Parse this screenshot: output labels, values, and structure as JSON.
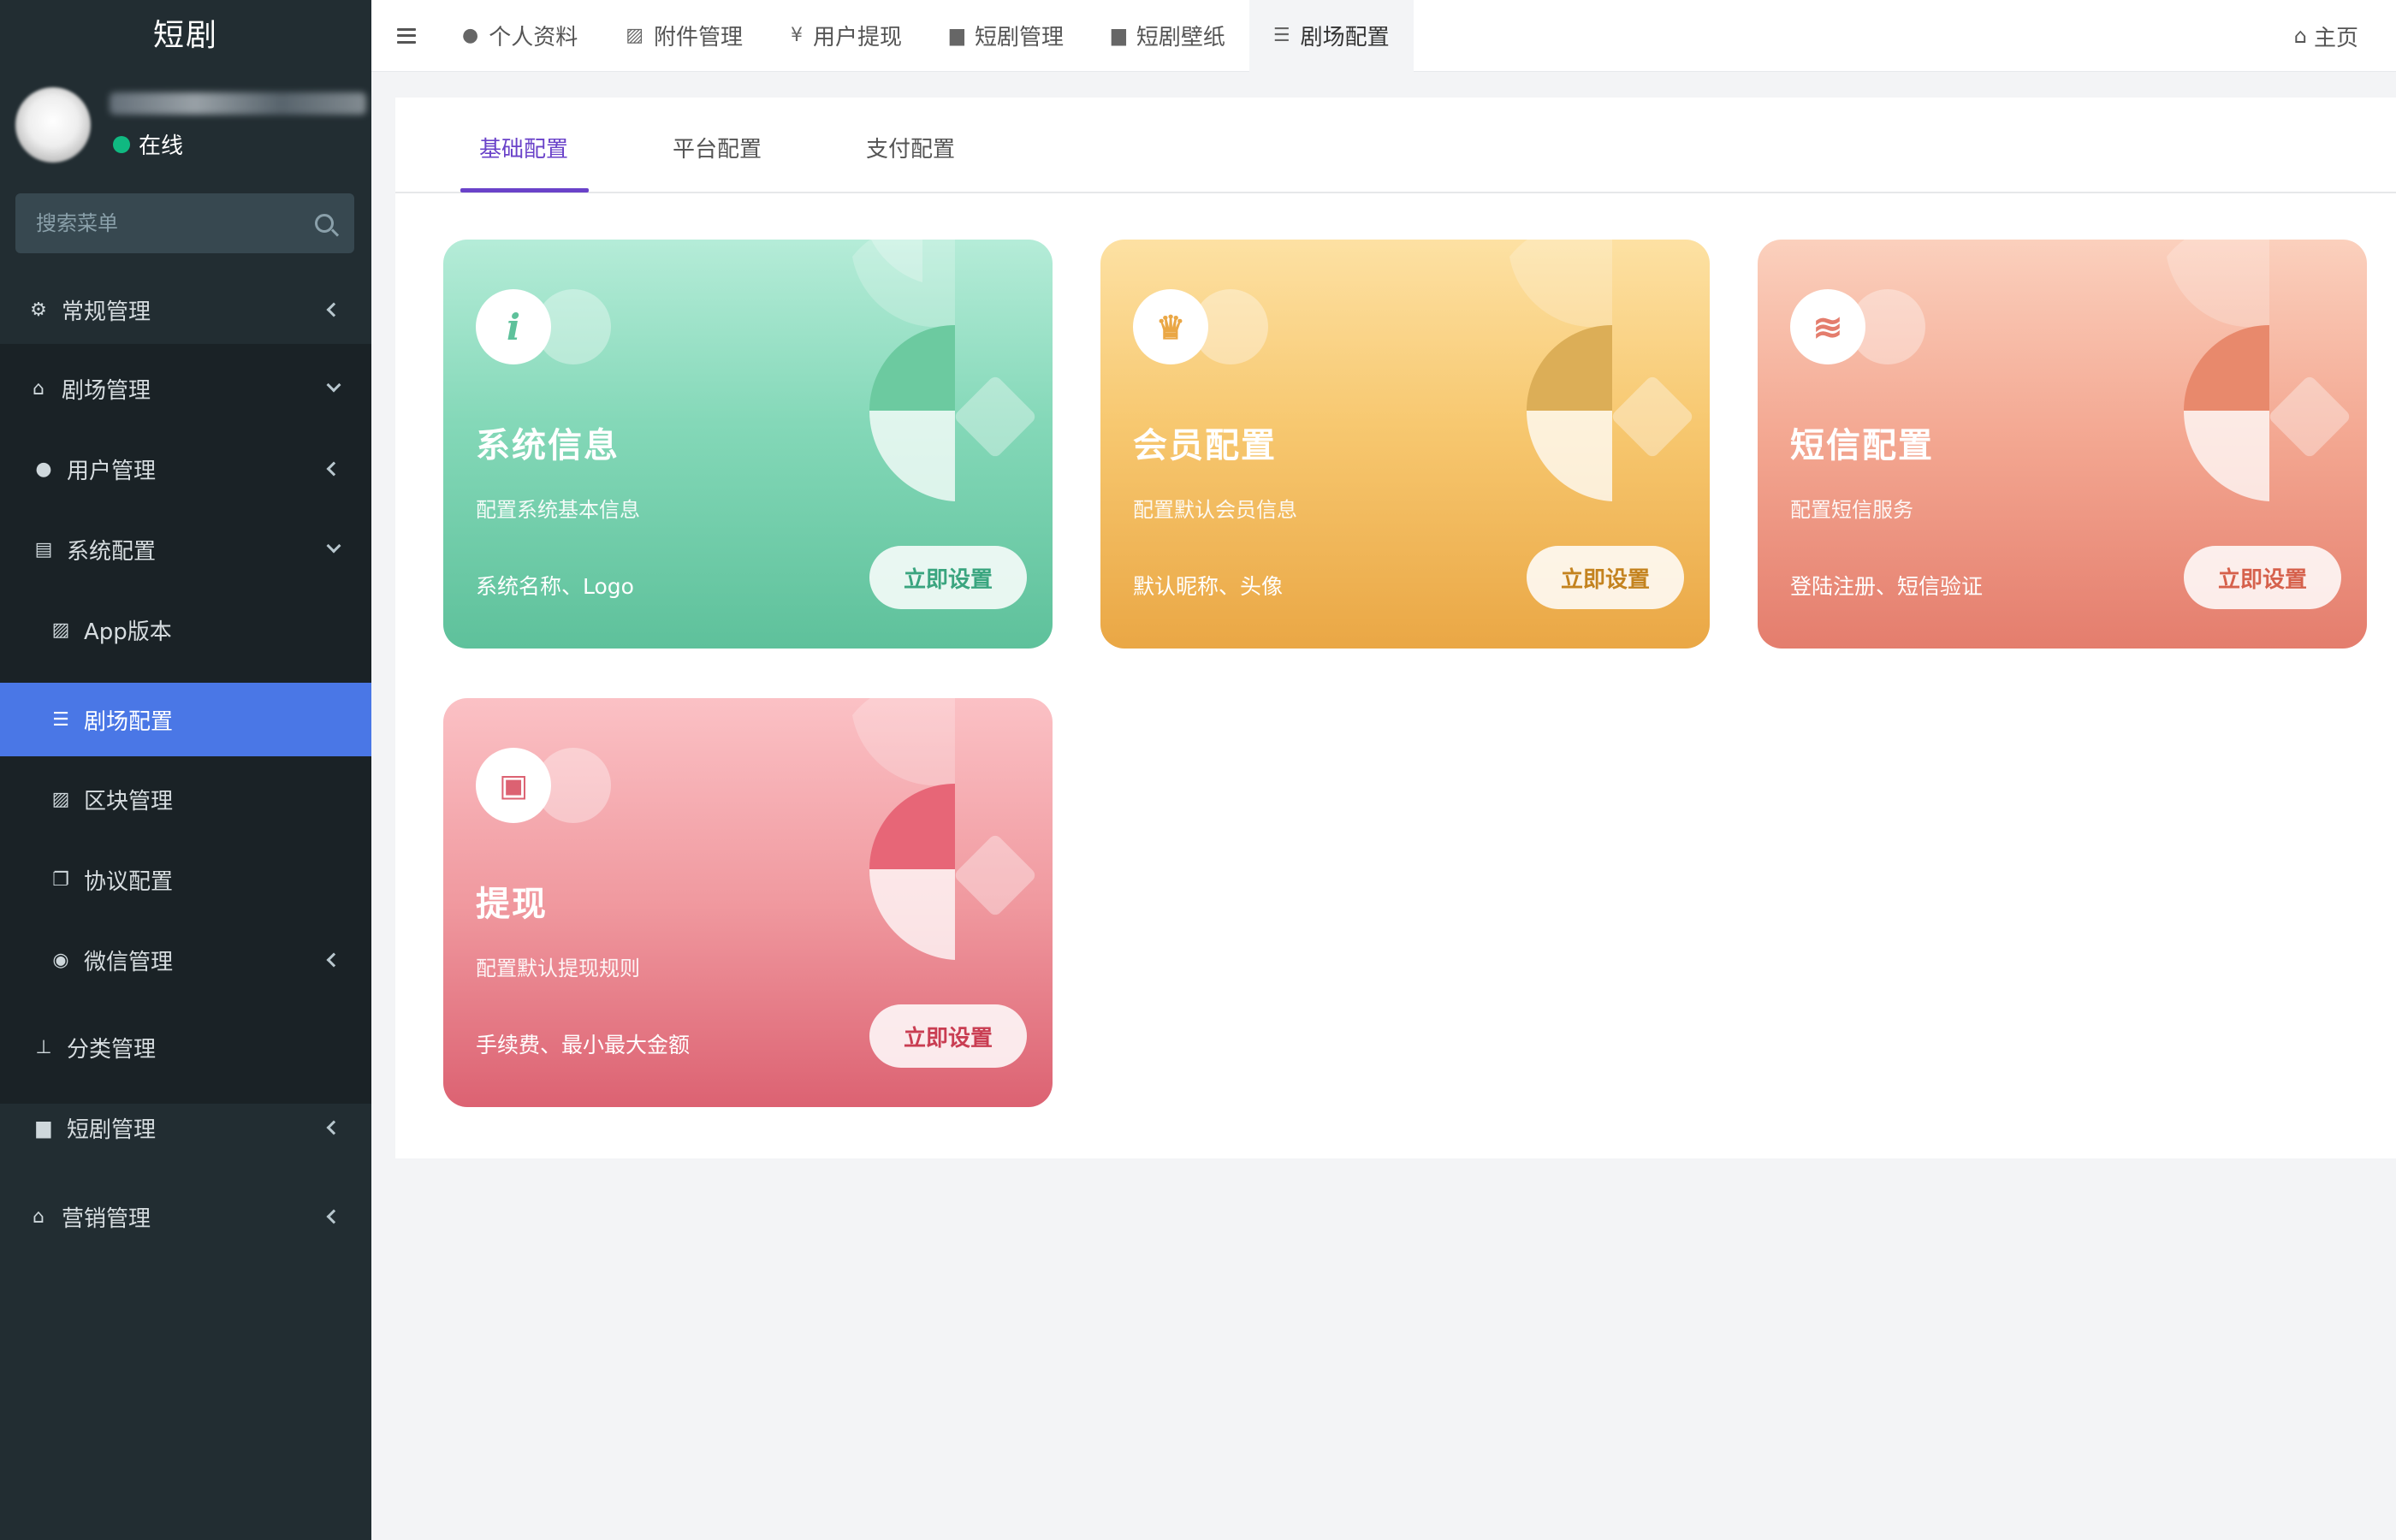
{
  "colors": {
    "sidebar_bg": "#222d32",
    "sidebar_sub_bg": "#1a2226",
    "sidebar_active": "#4a77e6",
    "online": "#10b981",
    "tab_active": "#6a42c9",
    "card_green": "#5ec19b",
    "card_orange": "#eaa745",
    "card_salmon": "#e47d6d",
    "card_pink": "#dc6272"
  },
  "sidebar": {
    "brand": "短剧",
    "user_status": "在线",
    "search_placeholder": "搜索菜单",
    "items": [
      {
        "label": "常规管理",
        "icon": "gears-icon"
      },
      {
        "label": "剧场管理",
        "icon": "home-icon"
      },
      {
        "label": "用户管理",
        "icon": "user-icon"
      },
      {
        "label": "系统配置",
        "icon": "file-icon"
      },
      {
        "label": "App版本",
        "icon": "image-icon"
      },
      {
        "label": "剧场配置",
        "icon": "sliders-icon"
      },
      {
        "label": "区块管理",
        "icon": "image-icon"
      },
      {
        "label": "协议配置",
        "icon": "copy-icon"
      },
      {
        "label": "微信管理",
        "icon": "wechat-icon"
      },
      {
        "label": "分类管理",
        "icon": "sitemap-icon"
      },
      {
        "label": "短剧管理",
        "icon": "bag-icon"
      },
      {
        "label": "营销管理",
        "icon": "home-icon"
      }
    ]
  },
  "topbar": {
    "tabs": [
      {
        "label": "个人资料",
        "icon": "user-icon"
      },
      {
        "label": "附件管理",
        "icon": "image-icon"
      },
      {
        "label": "用户提现",
        "icon": "yen-icon"
      },
      {
        "label": "短剧管理",
        "icon": "bag-icon"
      },
      {
        "label": "短剧壁纸",
        "icon": "bag-icon"
      },
      {
        "label": "剧场配置",
        "icon": "sliders-icon"
      }
    ],
    "home": "主页"
  },
  "content": {
    "tabs": [
      "基础配置",
      "平台配置",
      "支付配置"
    ],
    "cards": [
      {
        "title": "系统信息",
        "desc": "配置系统基本信息",
        "foot": "系统名称、Logo",
        "button": "立即设置",
        "icon": "info-icon",
        "icon_glyph": "i",
        "accent": "#3aa57f"
      },
      {
        "title": "会员配置",
        "desc": "配置默认会员信息",
        "foot": "默认昵称、头像",
        "button": "立即设置",
        "icon": "crown-icon",
        "icon_glyph": "♛",
        "accent": "#c4831f"
      },
      {
        "title": "短信配置",
        "desc": "配置短信服务",
        "foot": "登陆注册、短信验证",
        "button": "立即设置",
        "icon": "database-icon",
        "icon_glyph": "≋",
        "accent": "#d6614c"
      },
      {
        "title": "提现",
        "desc": "配置默认提现规则",
        "foot": "手续费、最小最大金额",
        "button": "立即设置",
        "icon": "wallet-icon",
        "icon_glyph": "▣",
        "accent": "#c93d52"
      }
    ]
  }
}
